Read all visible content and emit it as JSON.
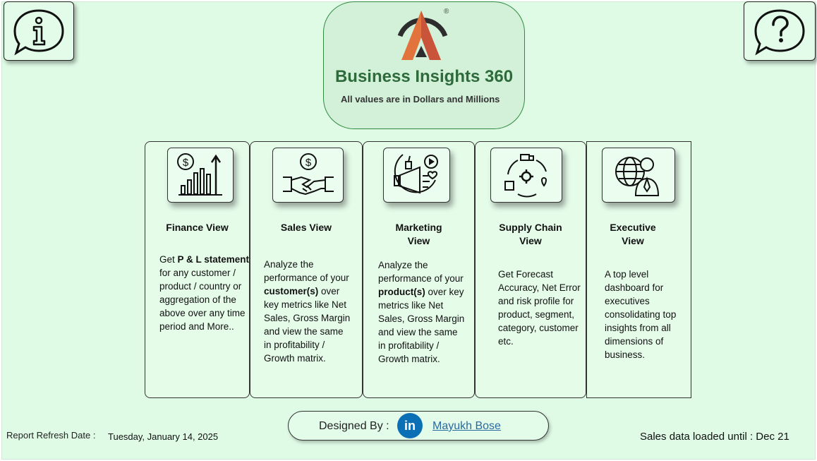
{
  "header": {
    "info_icon": "info-speech-bubble-icon",
    "help_icon": "help-speech-bubble-icon",
    "brand_title": "Business Insights 360",
    "brand_subtitle": "All values are in Dollars and Millions",
    "logo_mark": "®",
    "colors": {
      "brand_green": "#2e6b3a",
      "background": "#dffbe6",
      "logo_orange": "#e2733c"
    }
  },
  "cards": [
    {
      "title": "Finance View",
      "icon": "finance-dollar-growth-icon",
      "desc_parts": [
        "Get ",
        "P & L statement",
        " for any customer /  product / country or aggregation of the above over any time period and More.."
      ]
    },
    {
      "title": "Sales View",
      "icon": "handshake-dollar-icon",
      "desc_parts": [
        "Analyze the performance of your ",
        "customer(s)",
        " over key metrics like Net Sales, Gross Margin and view the same in profitability / Growth matrix."
      ]
    },
    {
      "title": "Marketing View",
      "icon": "megaphone-marketing-icon",
      "desc_parts": [
        "Analyze  the performance of your ",
        "product(s)",
        " over key metrics like Net Sales, Gross Margin and view the same in profitability / Growth matrix."
      ]
    },
    {
      "title": "Supply Chain View",
      "icon": "supply-chain-cycle-icon",
      "desc_parts": [
        "Get Forecast Accuracy, Net Error and risk profile for product, segment, category, customer etc."
      ]
    },
    {
      "title": "Executive View",
      "icon": "executive-globe-icon",
      "desc_parts": [
        "A top level dashboard for executives consolidating top insights from all dimensions of business."
      ]
    }
  ],
  "footer": {
    "designed_by_label": "Designed By :",
    "linkedin_icon": "linkedin-icon",
    "linkedin_text": "in",
    "designer_name": "Mayukh Bose",
    "refresh_label": "Report Refresh Date :",
    "refresh_value": "Tuesday, January 14, 2025",
    "sales_loaded": "Sales data loaded until : Dec 21"
  }
}
